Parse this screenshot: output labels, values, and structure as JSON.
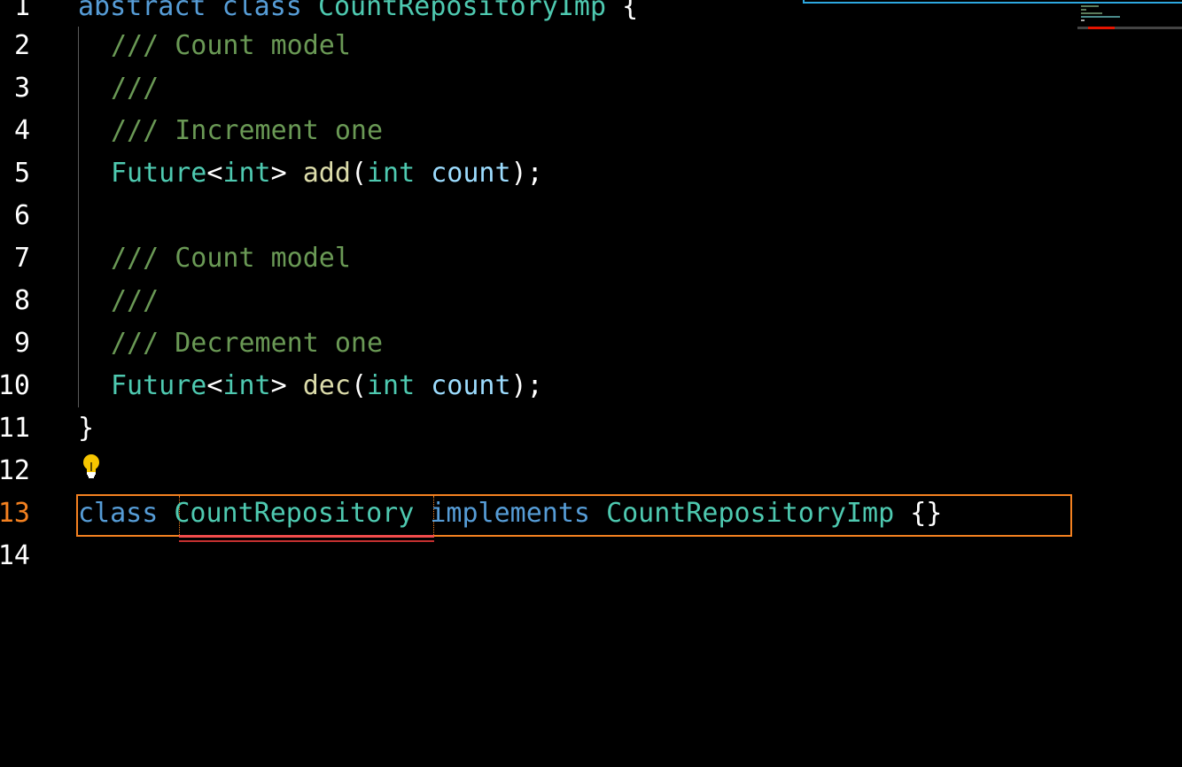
{
  "editor": {
    "active_line": "13",
    "line_numbers": [
      "1",
      "2",
      "3",
      "4",
      "5",
      "6",
      "7",
      "8",
      "9",
      "10",
      "11",
      "12",
      "13",
      "14"
    ],
    "lines": {
      "l1": {
        "kw1": "abstract",
        "kw2": "class",
        "type": "CountRepositoryImp",
        "brace": "{"
      },
      "l2": {
        "comment": "/// Count model"
      },
      "l3": {
        "comment": "///"
      },
      "l4": {
        "comment": "/// Increment one"
      },
      "l5": {
        "type1": "Future",
        "lt": "<",
        "type2": "int",
        "gt": ">",
        "fn": "add",
        "open": "(",
        "ptype": "int",
        "param": "count",
        "close": ");"
      },
      "l7": {
        "comment": "/// Count model"
      },
      "l8": {
        "comment": "///"
      },
      "l9": {
        "comment": "/// Decrement one"
      },
      "l10": {
        "type1": "Future",
        "lt": "<",
        "type2": "int",
        "gt": ">",
        "fn": "dec",
        "open": "(",
        "ptype": "int",
        "param": "count",
        "close": ");"
      },
      "l11": {
        "brace": "}"
      },
      "l13": {
        "kw": "class",
        "type": "CountRepository",
        "kw2": "implements",
        "type2": "CountRepositoryImp",
        "braces": "{}"
      }
    }
  },
  "colors": {
    "keyword": "#569cd6",
    "type": "#4ec9b0",
    "function": "#dcdcaa",
    "parameter": "#9cdcfe",
    "comment": "#6a9955",
    "active_line_number": "#f48120",
    "error": "#f14c4c"
  },
  "icons": {
    "lightbulb": "lightbulb-icon"
  }
}
